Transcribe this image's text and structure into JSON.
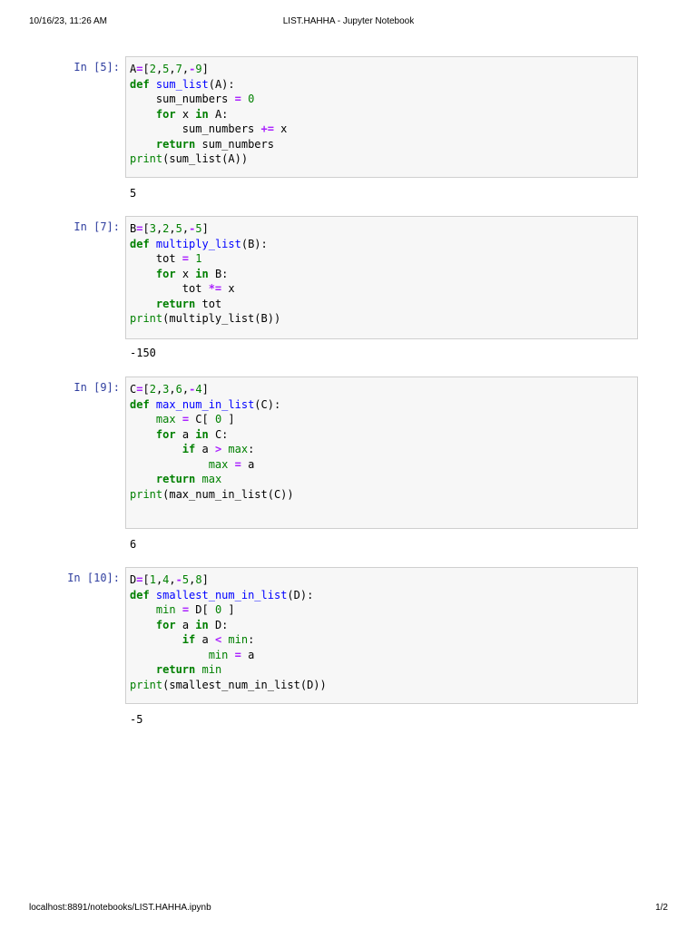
{
  "header": {
    "date": "10/16/23, 11:26 AM",
    "title": "LIST.HAHHA - Jupyter Notebook"
  },
  "footer": {
    "url": "localhost:8891/notebooks/LIST.HAHHA.ipynb",
    "page": "1/2"
  },
  "cells": [
    {
      "prompt": "In [5]:",
      "output": "5",
      "code": [
        [
          {
            "t": "A"
          },
          {
            "t": "=",
            "c": "o"
          },
          {
            "t": "["
          },
          {
            "t": "2",
            "c": "n"
          },
          {
            "t": ","
          },
          {
            "t": "5",
            "c": "n"
          },
          {
            "t": ","
          },
          {
            "t": "7",
            "c": "n"
          },
          {
            "t": ","
          },
          {
            "t": "-",
            "c": "o"
          },
          {
            "t": "9",
            "c": "n"
          },
          {
            "t": "]"
          }
        ],
        [
          {
            "t": "def",
            "c": "k"
          },
          {
            "t": " "
          },
          {
            "t": "sum_list",
            "c": "f"
          },
          {
            "t": "(A):"
          }
        ],
        [
          {
            "t": "    sum_numbers "
          },
          {
            "t": "=",
            "c": "o"
          },
          {
            "t": " "
          },
          {
            "t": "0",
            "c": "n"
          }
        ],
        [
          {
            "t": "    "
          },
          {
            "t": "for",
            "c": "k"
          },
          {
            "t": " x "
          },
          {
            "t": "in",
            "c": "k"
          },
          {
            "t": " A:"
          }
        ],
        [
          {
            "t": "        sum_numbers "
          },
          {
            "t": "+=",
            "c": "o"
          },
          {
            "t": " x"
          }
        ],
        [
          {
            "t": "    "
          },
          {
            "t": "return",
            "c": "k"
          },
          {
            "t": " sum_numbers"
          }
        ],
        [
          {
            "t": "print",
            "c": "b"
          },
          {
            "t": "(sum_list(A))"
          }
        ]
      ]
    },
    {
      "prompt": "In [7]:",
      "output": "-150",
      "code": [
        [
          {
            "t": "B"
          },
          {
            "t": "=",
            "c": "o"
          },
          {
            "t": "["
          },
          {
            "t": "3",
            "c": "n"
          },
          {
            "t": ","
          },
          {
            "t": "2",
            "c": "n"
          },
          {
            "t": ","
          },
          {
            "t": "5",
            "c": "n"
          },
          {
            "t": ","
          },
          {
            "t": "-",
            "c": "o"
          },
          {
            "t": "5",
            "c": "n"
          },
          {
            "t": "]"
          }
        ],
        [
          {
            "t": "def",
            "c": "k"
          },
          {
            "t": " "
          },
          {
            "t": "multiply_list",
            "c": "f"
          },
          {
            "t": "(B):"
          }
        ],
        [
          {
            "t": "    tot "
          },
          {
            "t": "=",
            "c": "o"
          },
          {
            "t": " "
          },
          {
            "t": "1",
            "c": "n"
          }
        ],
        [
          {
            "t": "    "
          },
          {
            "t": "for",
            "c": "k"
          },
          {
            "t": " x "
          },
          {
            "t": "in",
            "c": "k"
          },
          {
            "t": " B:"
          }
        ],
        [
          {
            "t": "        tot "
          },
          {
            "t": "*=",
            "c": "o"
          },
          {
            "t": " x"
          }
        ],
        [
          {
            "t": "    "
          },
          {
            "t": "return",
            "c": "k"
          },
          {
            "t": " tot"
          }
        ],
        [
          {
            "t": "print",
            "c": "b"
          },
          {
            "t": "(multiply_list(B))"
          }
        ]
      ]
    },
    {
      "prompt": "In [9]:",
      "output": "6",
      "code": [
        [
          {
            "t": "C"
          },
          {
            "t": "=",
            "c": "o"
          },
          {
            "t": "["
          },
          {
            "t": "2",
            "c": "n"
          },
          {
            "t": ","
          },
          {
            "t": "3",
            "c": "n"
          },
          {
            "t": ","
          },
          {
            "t": "6",
            "c": "n"
          },
          {
            "t": ","
          },
          {
            "t": "-",
            "c": "o"
          },
          {
            "t": "4",
            "c": "n"
          },
          {
            "t": "]"
          }
        ],
        [
          {
            "t": "def",
            "c": "k"
          },
          {
            "t": " "
          },
          {
            "t": "max_num_in_list",
            "c": "f"
          },
          {
            "t": "(C):"
          }
        ],
        [
          {
            "t": "    "
          },
          {
            "t": "max",
            "c": "b"
          },
          {
            "t": " "
          },
          {
            "t": "=",
            "c": "o"
          },
          {
            "t": " C[ "
          },
          {
            "t": "0",
            "c": "n"
          },
          {
            "t": " ]"
          }
        ],
        [
          {
            "t": "    "
          },
          {
            "t": "for",
            "c": "k"
          },
          {
            "t": " a "
          },
          {
            "t": "in",
            "c": "k"
          },
          {
            "t": " C:"
          }
        ],
        [
          {
            "t": "        "
          },
          {
            "t": "if",
            "c": "k"
          },
          {
            "t": " a "
          },
          {
            "t": ">",
            "c": "o"
          },
          {
            "t": " "
          },
          {
            "t": "max",
            "c": "b"
          },
          {
            "t": ":"
          }
        ],
        [
          {
            "t": "            "
          },
          {
            "t": "max",
            "c": "b"
          },
          {
            "t": " "
          },
          {
            "t": "=",
            "c": "o"
          },
          {
            "t": " a"
          }
        ],
        [
          {
            "t": "    "
          },
          {
            "t": "return",
            "c": "k"
          },
          {
            "t": " "
          },
          {
            "t": "max",
            "c": "b"
          }
        ],
        [
          {
            "t": "print",
            "c": "b"
          },
          {
            "t": "(max_num_in_list(C))"
          }
        ],
        [
          {
            "t": ""
          }
        ]
      ]
    },
    {
      "prompt": "In [10]:",
      "output": "-5",
      "code": [
        [
          {
            "t": "D"
          },
          {
            "t": "=",
            "c": "o"
          },
          {
            "t": "["
          },
          {
            "t": "1",
            "c": "n"
          },
          {
            "t": ","
          },
          {
            "t": "4",
            "c": "n"
          },
          {
            "t": ","
          },
          {
            "t": "-",
            "c": "o"
          },
          {
            "t": "5",
            "c": "n"
          },
          {
            "t": ","
          },
          {
            "t": "8",
            "c": "n"
          },
          {
            "t": "]"
          }
        ],
        [
          {
            "t": "def",
            "c": "k"
          },
          {
            "t": " "
          },
          {
            "t": "smallest_num_in_list",
            "c": "f"
          },
          {
            "t": "(D):"
          }
        ],
        [
          {
            "t": "    "
          },
          {
            "t": "min",
            "c": "b"
          },
          {
            "t": " "
          },
          {
            "t": "=",
            "c": "o"
          },
          {
            "t": " D[ "
          },
          {
            "t": "0",
            "c": "n"
          },
          {
            "t": " ]"
          }
        ],
        [
          {
            "t": "    "
          },
          {
            "t": "for",
            "c": "k"
          },
          {
            "t": " a "
          },
          {
            "t": "in",
            "c": "k"
          },
          {
            "t": " D:"
          }
        ],
        [
          {
            "t": "        "
          },
          {
            "t": "if",
            "c": "k"
          },
          {
            "t": " a "
          },
          {
            "t": "<",
            "c": "o"
          },
          {
            "t": " "
          },
          {
            "t": "min",
            "c": "b"
          },
          {
            "t": ":"
          }
        ],
        [
          {
            "t": "            "
          },
          {
            "t": "min",
            "c": "b"
          },
          {
            "t": " "
          },
          {
            "t": "=",
            "c": "o"
          },
          {
            "t": " a"
          }
        ],
        [
          {
            "t": "    "
          },
          {
            "t": "return",
            "c": "k"
          },
          {
            "t": " "
          },
          {
            "t": "min",
            "c": "b"
          }
        ],
        [
          {
            "t": "print",
            "c": "b"
          },
          {
            "t": "(smallest_num_in_list(D))"
          }
        ]
      ]
    }
  ]
}
